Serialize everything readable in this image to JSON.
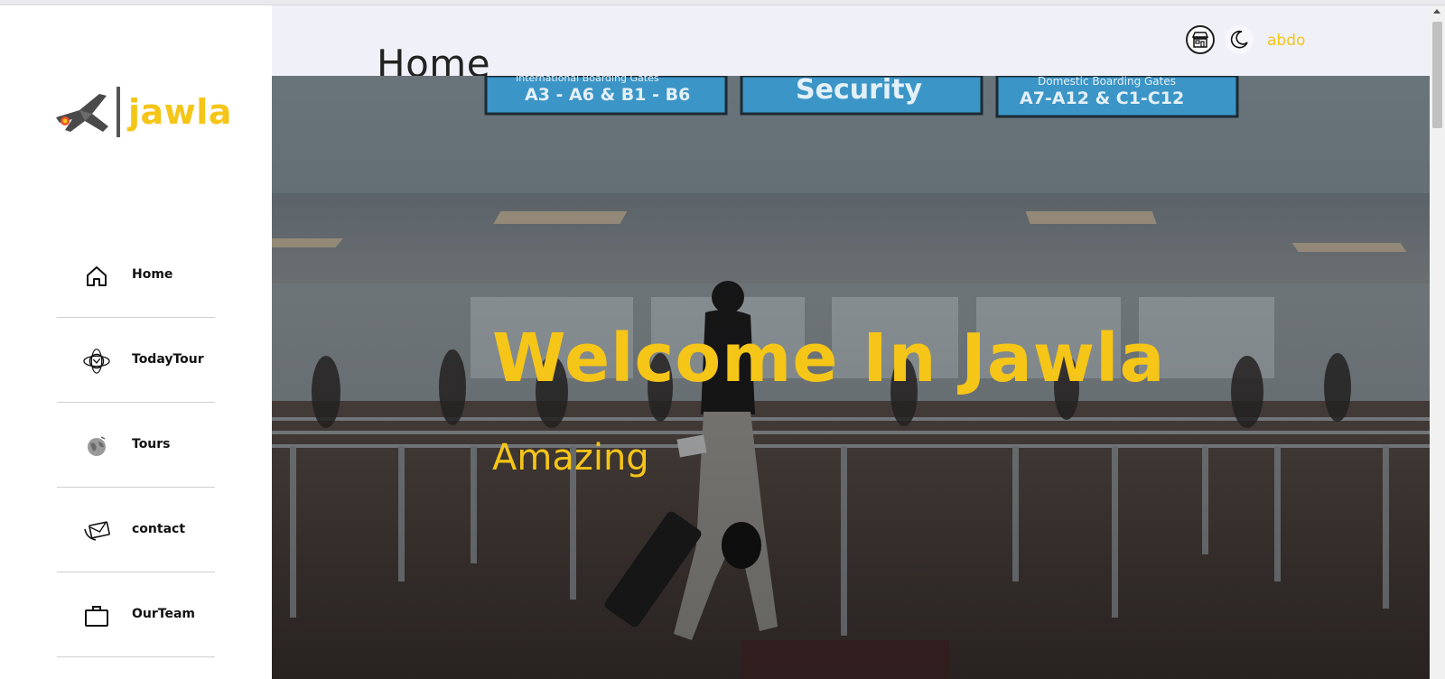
{
  "brand": {
    "logo_text": "jawla",
    "accent_color": "#f5c518",
    "logo_icon": "jet-plane-icon"
  },
  "sidebar": {
    "items": [
      {
        "label": "Home",
        "icon": "house-icon"
      },
      {
        "label": "TodayTour",
        "icon": "globe-orbit-icon"
      },
      {
        "label": "Tours",
        "icon": "globe-icon"
      },
      {
        "label": "contact",
        "icon": "envelope-icon"
      },
      {
        "label": "OurTeam",
        "icon": "briefcase-icon"
      }
    ]
  },
  "header": {
    "title": "Home",
    "icons": [
      "store-icon",
      "moon-icon"
    ],
    "username": "abdo"
  },
  "hero": {
    "title": "Welcome In Jawla",
    "subtitle": "Amazing",
    "signs": [
      "A3 - A6 & B1 - B6",
      "Security",
      "A7-A12 & C1-C12"
    ],
    "sign_headers": [
      "International Boarding Gates",
      "Domestic Boarding Gates"
    ]
  }
}
